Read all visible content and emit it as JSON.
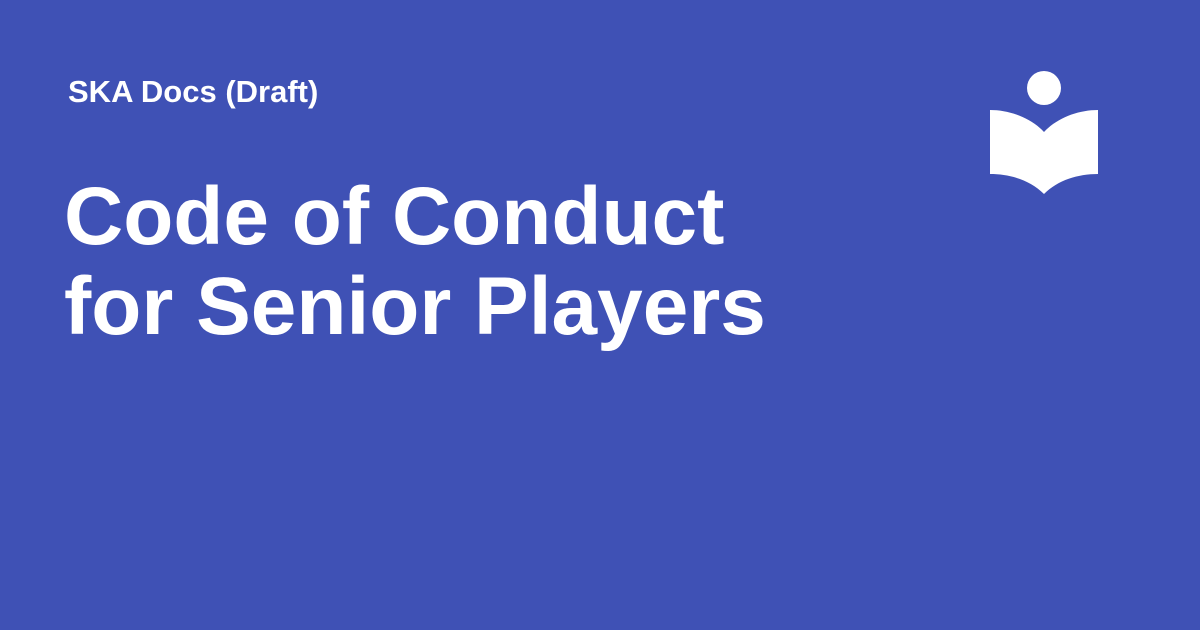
{
  "site": {
    "name": "SKA Docs (Draft)"
  },
  "page": {
    "title_lines": [
      "Code of Conduct",
      "for Senior Players"
    ]
  },
  "logo": {
    "icon": "reading-person-book-icon"
  },
  "colors": {
    "background": "#3f51b5",
    "text": "#ffffff"
  }
}
